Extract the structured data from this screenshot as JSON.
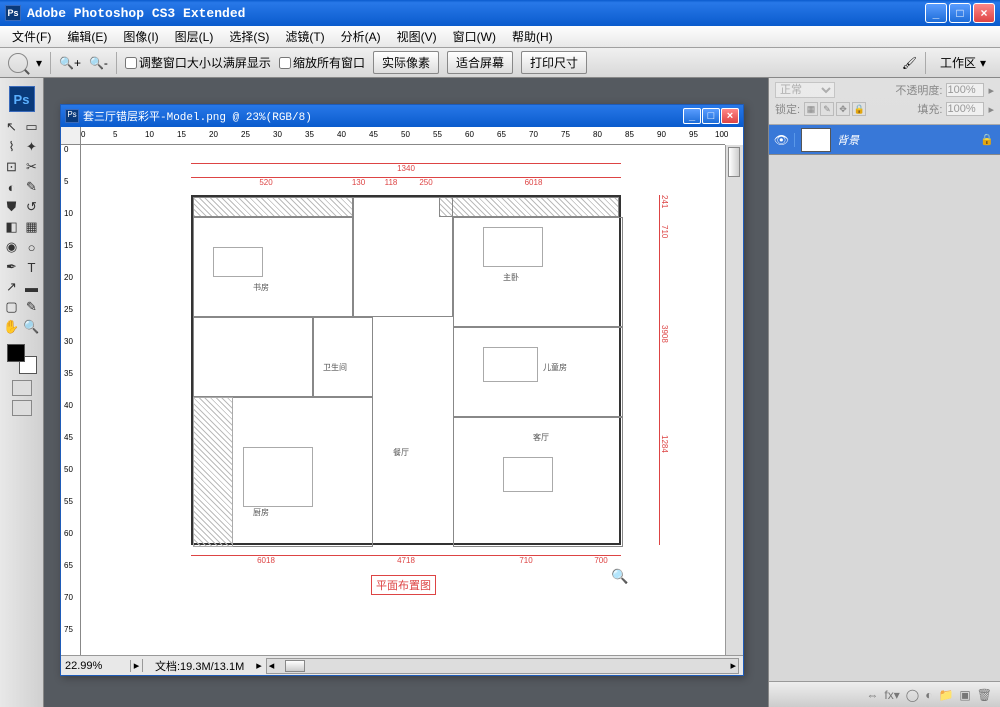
{
  "app": {
    "title": "Adobe Photoshop CS3 Extended",
    "icon_label": "Ps"
  },
  "menu": {
    "items": [
      "文件(F)",
      "编辑(E)",
      "图像(I)",
      "图层(L)",
      "选择(S)",
      "滤镜(T)",
      "分析(A)",
      "视图(V)",
      "窗口(W)",
      "帮助(H)"
    ]
  },
  "options": {
    "check1": "调整窗口大小以满屏显示",
    "check2": "缩放所有窗口",
    "btn1": "实际像素",
    "btn2": "适合屏幕",
    "btn3": "打印尺寸",
    "workspace": "工作区"
  },
  "document": {
    "title": "套三厅错层彩平-Model.png @ 23%(RGB/8)",
    "zoom": "22.99%",
    "info": "文档:19.3M/13.1M",
    "ruler_h": [
      "0",
      "5",
      "10",
      "15",
      "20",
      "25",
      "30",
      "35",
      "40",
      "45",
      "50",
      "55",
      "60",
      "65",
      "70",
      "75",
      "80",
      "85",
      "90",
      "95",
      "100"
    ],
    "ruler_v": [
      "0",
      "5",
      "10",
      "15",
      "20",
      "25",
      "30",
      "35",
      "40",
      "45",
      "50",
      "55",
      "60",
      "65",
      "70",
      "75"
    ]
  },
  "floorplan": {
    "title": "平面布置图",
    "dims_top": [
      "1340",
      "520",
      "130",
      "118",
      "250",
      "6018"
    ],
    "dims_right": [
      "241",
      "710",
      "3908",
      "1284"
    ],
    "labels": [
      "书房",
      "主卧",
      "儿童房",
      "厨房",
      "客厅",
      "卫生间",
      "餐厅"
    ]
  },
  "layers": {
    "blend_mode": "正常",
    "opacity_label": "不透明度:",
    "opacity_value": "100%",
    "lock_label": "锁定:",
    "fill_label": "填充:",
    "fill_value": "100%",
    "items": [
      {
        "name": "背景",
        "visible": true,
        "locked": true
      }
    ]
  }
}
